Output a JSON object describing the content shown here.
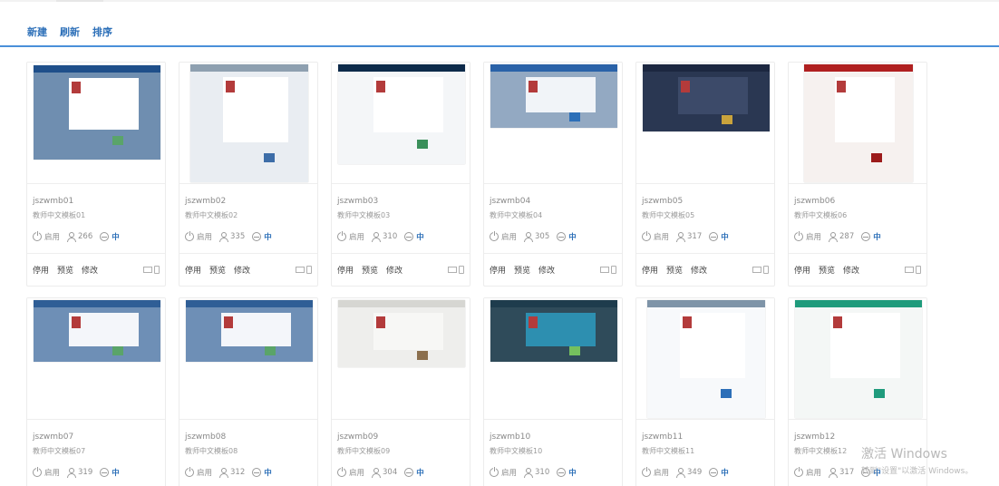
{
  "toolbar": {
    "new_label": "新建",
    "refresh_label": "刷新",
    "sort_label": "排序"
  },
  "colors": {
    "accent": "#2c6fb8",
    "divider": "#4a90d9"
  },
  "ops_labels": {
    "disable": "停用",
    "preview": "预览",
    "edit": "修改"
  },
  "templates": [
    {
      "code": "jszwmb01",
      "name": "教师中文模板01",
      "status": "启用",
      "count": "266",
      "lang": "中",
      "theme": "campus-blue"
    },
    {
      "code": "jszwmb02",
      "name": "教师中文模板02",
      "status": "启用",
      "count": "335",
      "lang": "中",
      "theme": "city-white"
    },
    {
      "code": "jszwmb03",
      "name": "教师中文模板03",
      "status": "启用",
      "count": "310",
      "lang": "中",
      "theme": "dark-sidebar"
    },
    {
      "code": "jszwmb04",
      "name": "教师中文模板04",
      "status": "启用",
      "count": "305",
      "lang": "中",
      "theme": "blue-overlay"
    },
    {
      "code": "jszwmb05",
      "name": "教师中文模板05",
      "status": "启用",
      "count": "317",
      "lang": "中",
      "theme": "navy-night"
    },
    {
      "code": "jszwmb06",
      "name": "教师中文模板06",
      "status": "启用",
      "count": "287",
      "lang": "中",
      "theme": "red-classic"
    },
    {
      "code": "jszwmb07",
      "name": "教师中文模板07",
      "status": "启用",
      "count": "319",
      "lang": "中",
      "theme": "sky-sunset"
    },
    {
      "code": "jszwmb08",
      "name": "教师中文模板08",
      "status": "启用",
      "count": "312",
      "lang": "中",
      "theme": "sky-sunset"
    },
    {
      "code": "jszwmb09",
      "name": "教师中文模板09",
      "status": "启用",
      "count": "304",
      "lang": "中",
      "theme": "ink-wash"
    },
    {
      "code": "jszwmb10",
      "name": "教师中文模板10",
      "status": "启用",
      "count": "310",
      "lang": "中",
      "theme": "teal-building"
    },
    {
      "code": "jszwmb11",
      "name": "教师中文模板11",
      "status": "启用",
      "count": "349",
      "lang": "中",
      "theme": "city-light"
    },
    {
      "code": "jszwmb12",
      "name": "教师中文模板12",
      "status": "启用",
      "count": "317",
      "lang": "中",
      "theme": "green-header"
    }
  ],
  "watermark": {
    "line1": "激活 Windows",
    "line2": "转到\"设置\"以激活 Windows。"
  }
}
